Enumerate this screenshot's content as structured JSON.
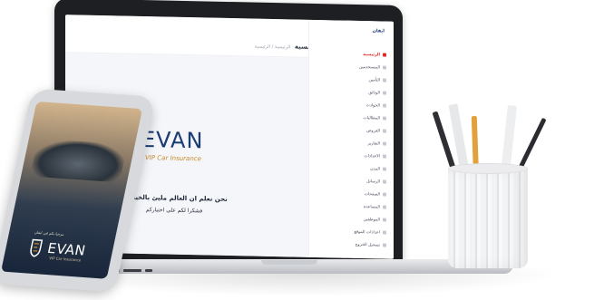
{
  "laptop": {
    "sidebar_brand": "ايفان",
    "breadcrumb_home": "الرئيسية",
    "breadcrumb_trail": "الرئيسية / الرئيسية",
    "menu_items": [
      {
        "label": "الرئيسية",
        "active": true
      },
      {
        "label": "المستخدمين",
        "active": false
      },
      {
        "label": "التأمين",
        "active": false
      },
      {
        "label": "الوثائق",
        "active": false
      },
      {
        "label": "الحوادث",
        "active": false
      },
      {
        "label": "المطالبات",
        "active": false
      },
      {
        "label": "العروض",
        "active": false
      },
      {
        "label": "التقارير",
        "active": false
      },
      {
        "label": "الاعدادات",
        "active": false
      },
      {
        "label": "المدن",
        "active": false
      },
      {
        "label": "الرسائل",
        "active": false
      },
      {
        "label": "الصفحات",
        "active": false
      },
      {
        "label": "المساعدة",
        "active": false
      },
      {
        "label": "الموظفين",
        "active": false
      },
      {
        "label": "اعدادات الموقع",
        "active": false
      },
      {
        "label": "تسجيل الخروج",
        "active": false
      }
    ],
    "logo_word": "EVAN",
    "logo_sub": "VIP Car Insurance",
    "welcome_message": "نحن نعلم ان العالم مليئ بالخيارات",
    "thanks_message": "فشكرا لكم على اختياركم"
  },
  "phone": {
    "welcome": "مرحبا بكم في ايفان",
    "logo_word": "EVAN",
    "logo_sub": "VIP Car Insurance"
  },
  "colors": {
    "brand_blue": "#1b3b73",
    "brand_gold": "#c98a2a",
    "accent_red": "#e0262b"
  }
}
